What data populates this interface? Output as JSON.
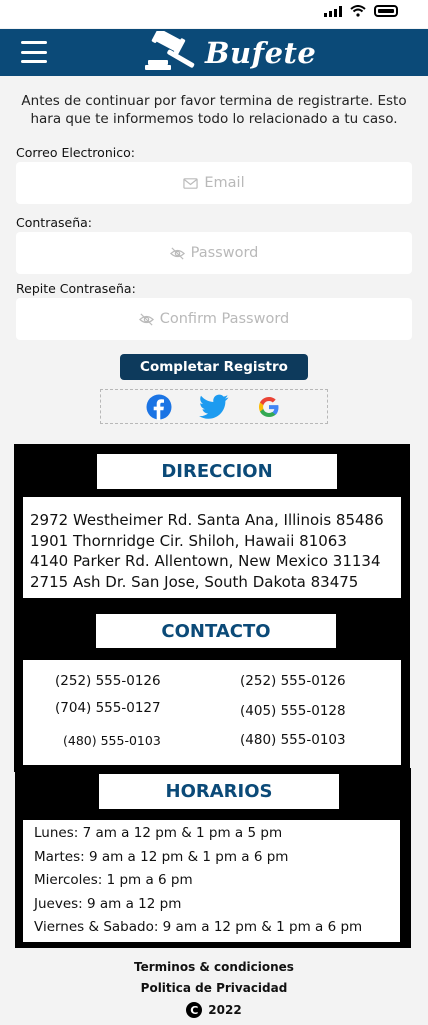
{
  "brand": {
    "name": "Bufete"
  },
  "intro": "Antes de continuar por favor termina de registrarte. Esto hara que te informemos todo lo relacionado a tu caso.",
  "form": {
    "email": {
      "label": "Correo Electronico:",
      "placeholder": "Email",
      "value": ""
    },
    "password": {
      "label": "Contraseña:",
      "placeholder": "Password",
      "value": ""
    },
    "confirm": {
      "label": "Repite Contraseña:",
      "placeholder": "Confirm Password",
      "value": ""
    },
    "submit_label": "Completar Registro"
  },
  "social": [
    "facebook-icon",
    "twitter-icon",
    "google-icon"
  ],
  "colors": {
    "brand": "#0b4a78",
    "button": "#0d3a5c",
    "facebook": "#1b74e4",
    "twitter": "#1d9bf0",
    "google": "#ea4335"
  },
  "direccion": {
    "title": "DIRECCION",
    "lines": [
      "2972 Westheimer Rd. Santa Ana, Illinois 85486",
      "1901 Thornridge Cir. Shiloh, Hawaii 81063",
      "4140 Parker Rd. Allentown, New Mexico 31134",
      "2715 Ash Dr. San Jose, South Dakota 83475"
    ]
  },
  "contacto": {
    "title": "CONTACTO",
    "phones": [
      "(252) 555-0126",
      "(252) 555-0126",
      "(704) 555-0127",
      "(405) 555-0128",
      "(480) 555-0103",
      "(480) 555-0103"
    ]
  },
  "horarios": {
    "title": "HORARIOS",
    "lines": [
      "Lunes: 7 am a 12 pm & 1 pm a 5 pm",
      "Martes: 9 am a 12 pm & 1 pm a 6 pm",
      "Miercoles: 1 pm a 6 pm",
      "Jueves: 9 am a 12 pm",
      "Viernes & Sabado: 9 am a 12 pm & 1 pm a 6 pm"
    ]
  },
  "footer": {
    "terms": "Terminos & condiciones",
    "privacy": "Politica de Privacidad",
    "copyright_symbol": "C",
    "year": "2022"
  }
}
